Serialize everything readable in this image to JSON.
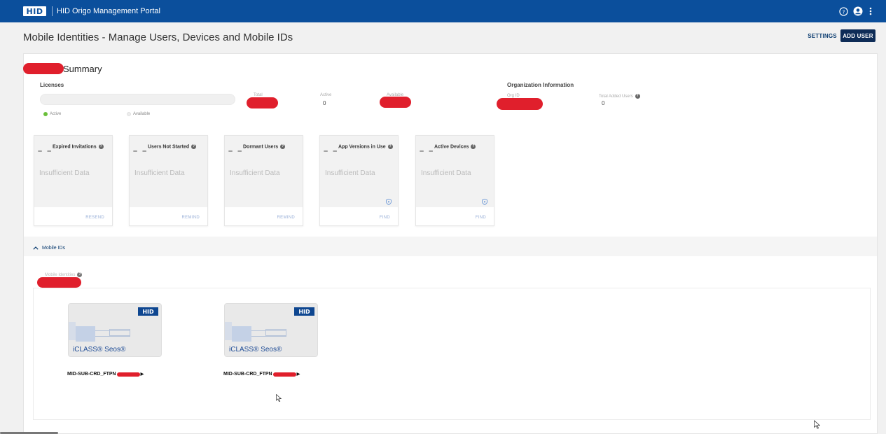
{
  "topbar": {
    "logo": "HID",
    "title": "HID Origo Management Portal",
    "icons": [
      "help-icon",
      "user-icon",
      "kebab-menu-icon"
    ]
  },
  "page": {
    "title": "Mobile Identities - Manage Users, Devices and Mobile IDs",
    "settings_label": "SETTINGS",
    "add_user_label": "ADD USER"
  },
  "summary": {
    "title": "Summary",
    "licenses": {
      "label": "Licenses",
      "legend_active": "Active",
      "legend_available": "Available",
      "total_label": "Total",
      "active_label": "Active",
      "active_value": "0",
      "available_label": "Available"
    },
    "org": {
      "title": "Organization Information",
      "org_id_label": "Org ID",
      "total_added_users_label": "Total Added Users",
      "total_added_users_value": "0"
    },
    "colors": {
      "active_dot": "#6abf3a",
      "available_dot": "#e8e8e8"
    }
  },
  "cards": [
    {
      "title": "Expired Invitations",
      "dash": "– –",
      "body": "Insufficient Data",
      "action": "RESEND",
      "shield": false
    },
    {
      "title": "Users Not Started",
      "dash": "– –",
      "body": "Insufficient Data",
      "action": "REMIND",
      "shield": false
    },
    {
      "title": "Dormant Users",
      "dash": "– –",
      "body": "Insufficient Data",
      "action": "REMIND",
      "shield": false
    },
    {
      "title": "App Versions in Use",
      "dash": "– –",
      "body": "Insufficient Data",
      "action": "FIND",
      "shield": true
    },
    {
      "title": "Active Devices",
      "dash": "– –",
      "body": "Insufficient Data",
      "action": "FIND",
      "shield": true
    }
  ],
  "mobile_ids": {
    "section_label": "Mobile IDs",
    "field_label": "Mobile Identities",
    "items": [
      {
        "badge": "HID",
        "brand": "iCLASS® Seos®",
        "name": "MID-SUB-CRD_FTPN"
      },
      {
        "badge": "HID",
        "brand": "iCLASS® Seos®",
        "name": "MID-SUB-CRD_FTPN"
      }
    ]
  }
}
